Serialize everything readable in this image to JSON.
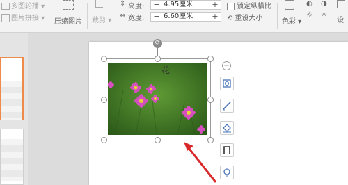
{
  "toolbar": {
    "multi_image_outline_partial": "多图轮播",
    "image_stitch": "图片拼接",
    "compress_image": "压缩图片",
    "crop": "裁剪",
    "height_label": "高度:",
    "height_value": "4.95厘米",
    "width_label": "宽度:",
    "width_value": "6.60厘米",
    "lock_ratio": "锁定纵横比",
    "reset_size": "重设大小",
    "color": "色彩",
    "settings_partial": "设"
  },
  "image": {
    "caption": "花"
  },
  "colors": {
    "accent": "#f08a4b",
    "arrow": "#d9282b"
  }
}
